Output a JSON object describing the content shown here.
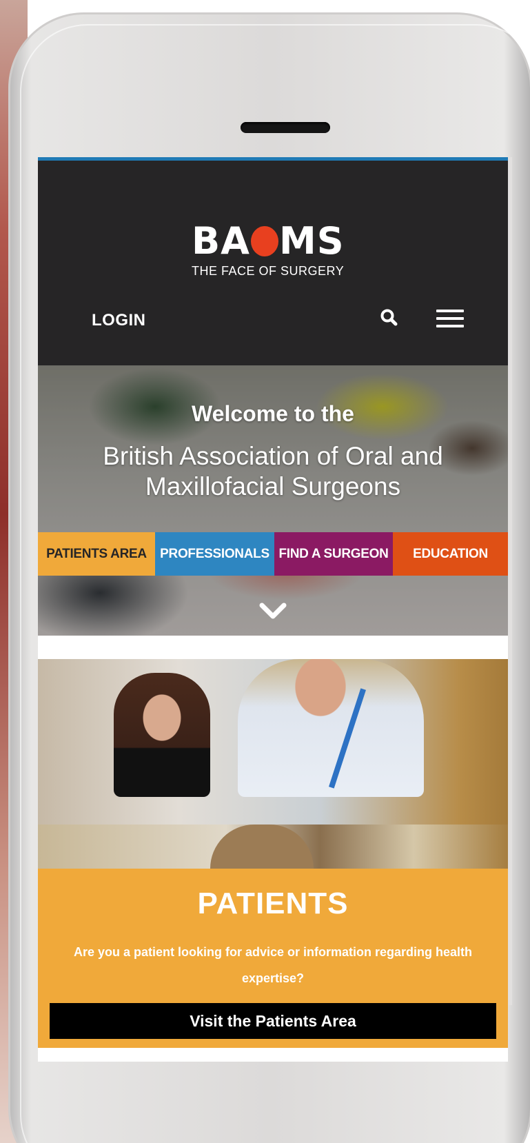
{
  "brand": {
    "logo_left": "BA",
    "logo_right": "MS",
    "tagline": "THE FACE OF SURGERY",
    "accent": "#e8401f"
  },
  "header": {
    "login_label": "LOGIN",
    "search_icon": "search-icon",
    "menu_icon": "hamburger-menu-icon",
    "background": "#262526"
  },
  "hero": {
    "line1": "Welcome to the",
    "line2": "British Association of Oral and Maxillofacial Surgeons",
    "scroll_icon": "chevron-down-icon"
  },
  "nav": {
    "tabs": [
      {
        "label": "PATIENTS AREA",
        "color": "#f0a93a"
      },
      {
        "label": "PROFESSIONALS",
        "color": "#2e86c1"
      },
      {
        "label": "FIND A SURGEON",
        "color": "#8b1a63"
      },
      {
        "label": "EDUCATION",
        "color": "#df5015"
      }
    ]
  },
  "patients": {
    "title": "PATIENTS",
    "text": "Are you a patient looking for advice or information regarding health expertise?",
    "button": "Visit the Patients Area"
  }
}
